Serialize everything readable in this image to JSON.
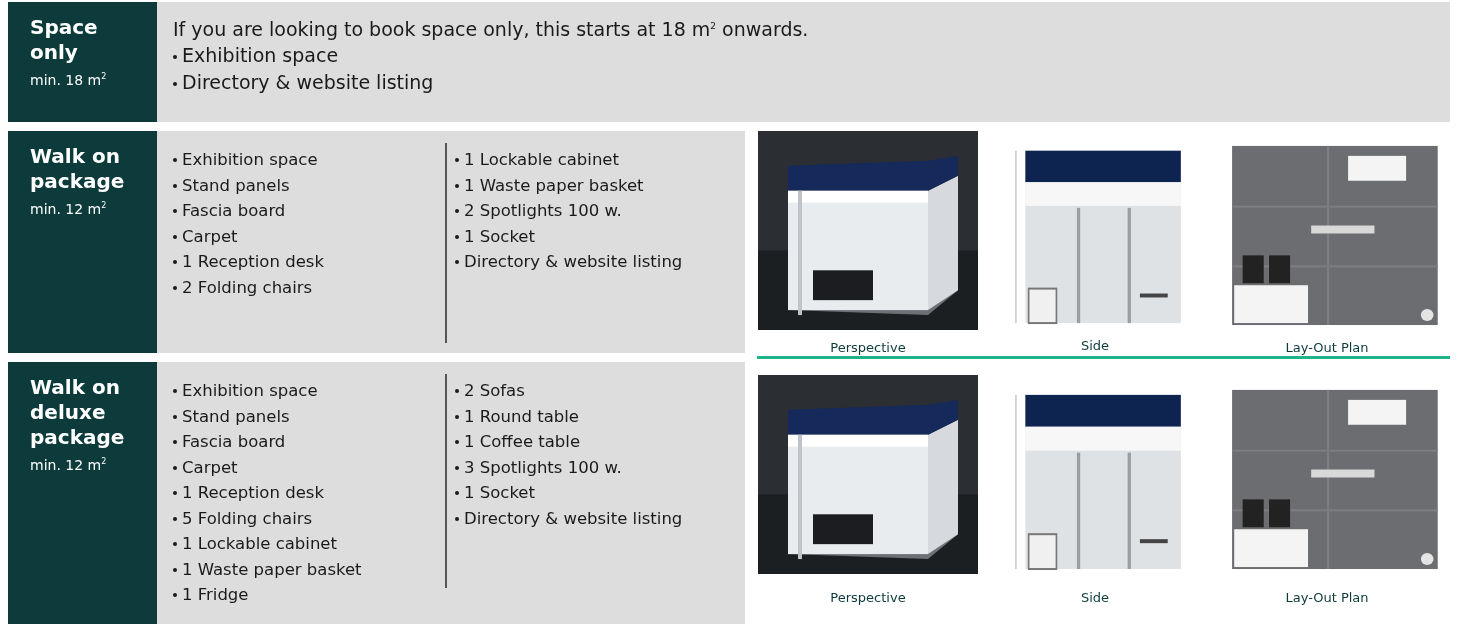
{
  "packages": [
    {
      "title": "Space only",
      "minimum": "min. 18 m$^{2}$",
      "intro": "If you are looking to book space only, this starts at 18 m$^{2}$ onwards.",
      "columns": [
        [
          "Exhibition space",
          "Directory & website listing"
        ]
      ]
    },
    {
      "title": "Walk on package",
      "minimum": "min. 12 m$^{2}$",
      "columns": [
        [
          "Exhibition space",
          "Stand panels",
          "Fascia board",
          "Carpet",
          "1 Reception desk",
          "2 Folding chairs"
        ],
        [
          "1 Lockable cabinet",
          "1 Waste paper basket",
          "2 Spotlights 100 w.",
          "1 Socket",
          "Directory & website listing"
        ]
      ],
      "views": [
        {
          "kind": "picture",
          "caption": "Perspective"
        },
        {
          "kind": "picture",
          "caption": "Side"
        },
        {
          "kind": "picture",
          "caption": "Lay-Out Plan"
        }
      ]
    },
    {
      "title": "Walk on deluxe package",
      "minimum": "min. 12 m$^{2}$",
      "columns": [
        [
          "Exhibition space",
          "Stand panels",
          "Fascia board",
          "Carpet",
          "1 Reception desk",
          "5 Folding chairs",
          "1 Lockable cabinet",
          "1 Waste paper basket",
          "1 Fridge"
        ],
        [
          "2 Sofas",
          "1 Round table",
          "1 Coffee table",
          "3 Spotlights 100 w.",
          "1 Socket",
          "Directory & website listing"
        ]
      ],
      "views": [
        {
          "kind": "picture",
          "caption": "Perspective"
        },
        {
          "kind": "picture",
          "caption": "Side"
        },
        {
          "kind": "picture",
          "caption": "Lay-Out Plan"
        }
      ]
    }
  ]
}
